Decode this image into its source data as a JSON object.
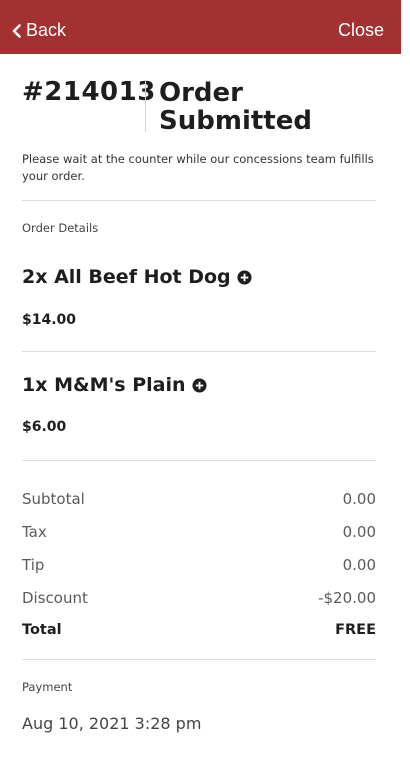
{
  "nav": {
    "back_label": "Back",
    "close_label": "Close"
  },
  "order": {
    "number": "#214013",
    "status": "Order Submitted",
    "notice": "Please wait at the counter while our concessions team fulfills your order."
  },
  "details": {
    "label": "Order Details",
    "items": [
      {
        "title": "2x All Beef Hot Dog",
        "price": "$14.00"
      },
      {
        "title": "1x M&M's Plain",
        "price": "$6.00"
      }
    ]
  },
  "summary": {
    "subtotal_label": "Subtotal",
    "subtotal_value": "0.00",
    "tax_label": "Tax",
    "tax_value": "0.00",
    "tip_label": "Tip",
    "tip_value": "0.00",
    "discount_label": "Discount",
    "discount_value": "-$20.00",
    "total_label": "Total",
    "total_value": "FREE"
  },
  "payment": {
    "label": "Payment",
    "date": "Aug 10, 2021 3:28 pm"
  },
  "colors": {
    "navbar": "#a33131",
    "text": "#1e1e1e",
    "divider": "#dcdcdc"
  },
  "icons": {
    "back": "chevron-left-icon",
    "item_info": "plus-circle-icon"
  }
}
